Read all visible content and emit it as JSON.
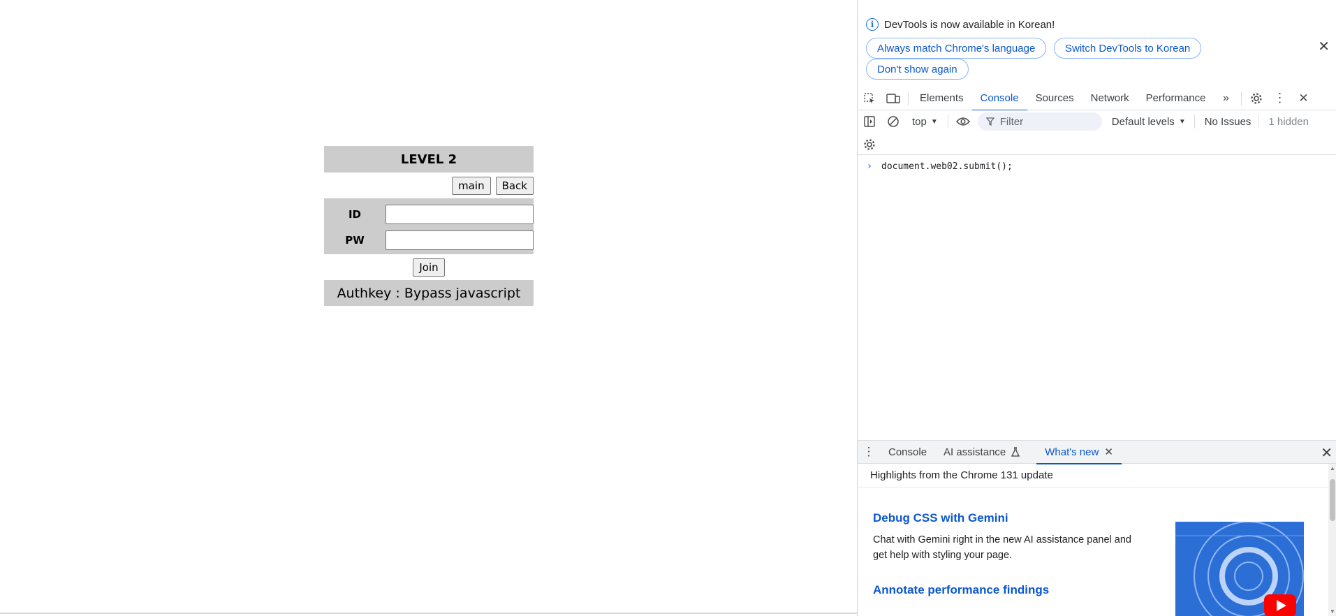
{
  "page": {
    "title": "LEVEL 2",
    "main_button": "main",
    "back_button": "Back",
    "id_label": "ID",
    "pw_label": "PW",
    "id_value": "",
    "pw_value": "",
    "join_button": "Join",
    "authkey": "Authkey : Bypass javascript"
  },
  "devtools": {
    "infobar": {
      "message": "DevTools is now available in Korean!",
      "buttons": [
        "Always match Chrome's language",
        "Switch DevTools to Korean",
        "Don't show again"
      ]
    },
    "tabs": [
      "Elements",
      "Console",
      "Sources",
      "Network",
      "Performance"
    ],
    "active_tab": "Console",
    "toolbar": {
      "context": "top",
      "filter_placeholder": "Filter",
      "levels": "Default levels",
      "issues": "No Issues",
      "hidden": "1 hidden"
    },
    "console_input": "document.web02.submit();",
    "drawer": {
      "tabs": [
        "Console",
        "AI assistance",
        "What's new"
      ],
      "active_tab": "What's new",
      "header": "Highlights from the Chrome 131 update",
      "items": [
        {
          "title": "Debug CSS with Gemini",
          "desc": "Chat with Gemini right in the new AI assistance panel and get help with styling your page."
        },
        {
          "title": "Annotate performance findings",
          "desc": ""
        }
      ]
    }
  },
  "colors": {
    "panel_gray": "#cccccc",
    "accent_blue": "#0b57d0",
    "youtube_red": "#ff0000"
  }
}
